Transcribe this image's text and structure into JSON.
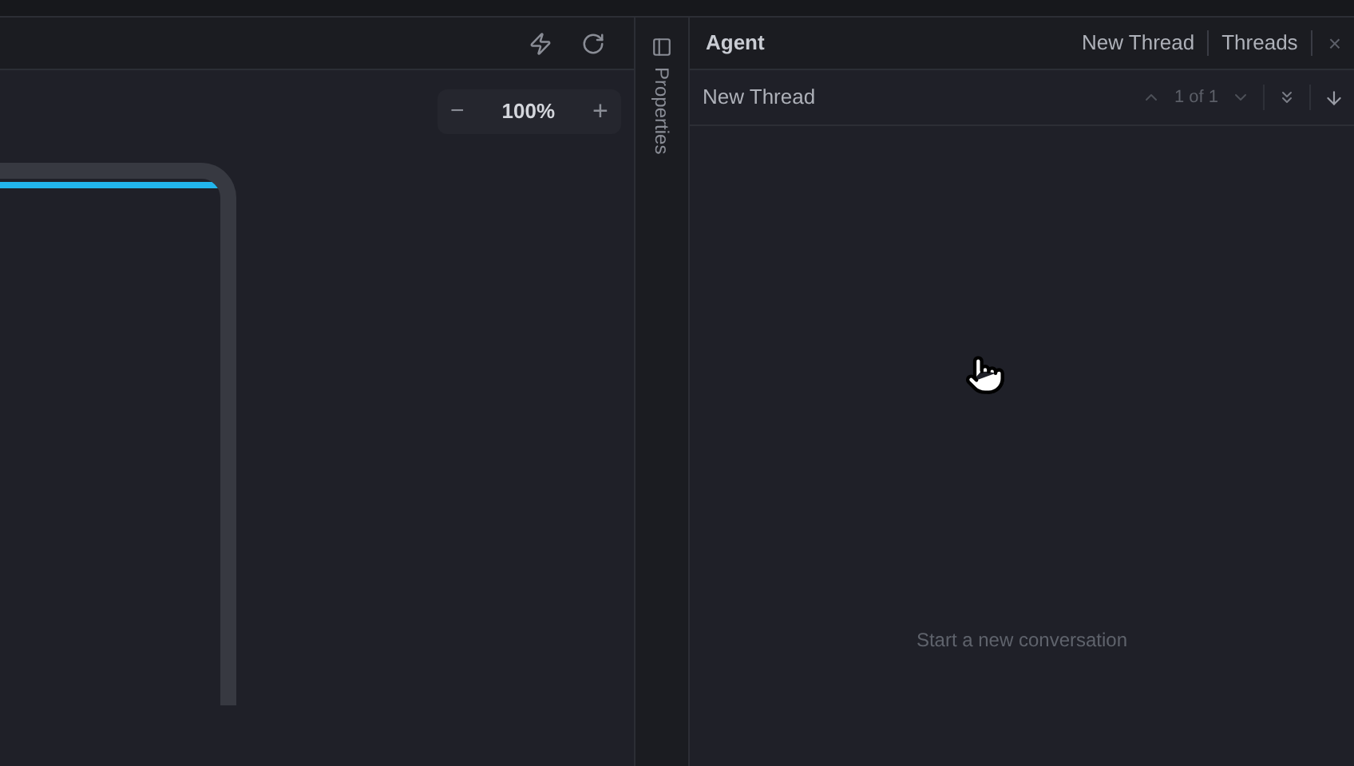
{
  "canvas": {
    "zoom": {
      "value": "100%",
      "decrease": "−",
      "increase": "+"
    }
  },
  "properties_rail": {
    "label": "Properties"
  },
  "agent": {
    "title": "Agent",
    "header_buttons": [
      "New Thread",
      "Threads"
    ],
    "close": "×",
    "thread": {
      "title": "New Thread",
      "counter": "1 of 1"
    },
    "empty_message": "Start a new conversation"
  }
}
